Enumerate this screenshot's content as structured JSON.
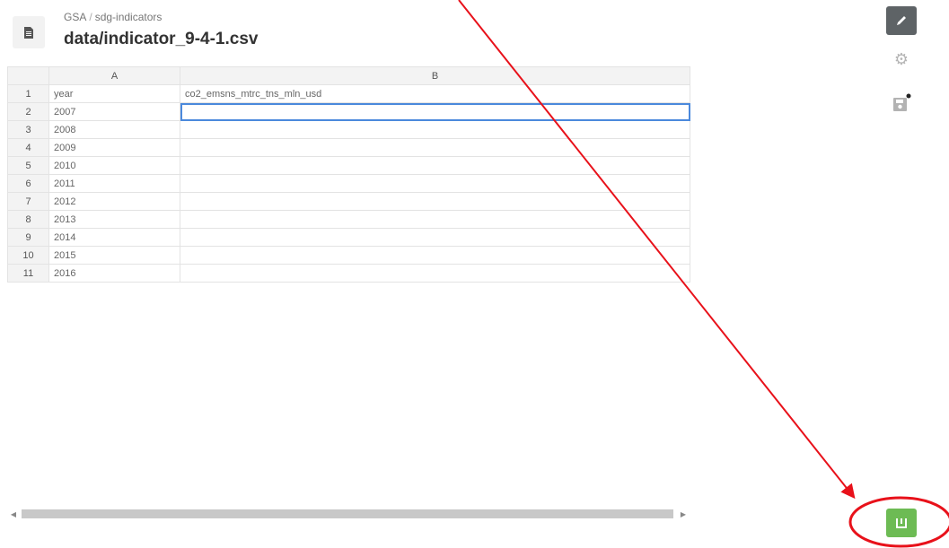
{
  "header": {
    "org": "GSA",
    "separator": "/",
    "repo": "sdg-indicators",
    "filename": "data/indicator_9-4-1.csv"
  },
  "grid": {
    "columns": [
      "A",
      "B"
    ],
    "rows": [
      {
        "num": "1",
        "a": "year",
        "b": "co2_emsns_mtrc_tns_mln_usd"
      },
      {
        "num": "2",
        "a": "2007",
        "b": ""
      },
      {
        "num": "3",
        "a": "2008",
        "b": ""
      },
      {
        "num": "4",
        "a": "2009",
        "b": ""
      },
      {
        "num": "5",
        "a": "2010",
        "b": ""
      },
      {
        "num": "6",
        "a": "2011",
        "b": ""
      },
      {
        "num": "7",
        "a": "2012",
        "b": ""
      },
      {
        "num": "8",
        "a": "2013",
        "b": ""
      },
      {
        "num": "9",
        "a": "2014",
        "b": ""
      },
      {
        "num": "10",
        "a": "2015",
        "b": ""
      },
      {
        "num": "11",
        "a": "2016",
        "b": ""
      }
    ],
    "selected_cell": "B2"
  },
  "toolbar": {
    "edit_icon": "pencil-icon",
    "settings_icon": "gear-icon",
    "save_icon": "save-icon",
    "publish_icon": "publish-icon"
  },
  "colors": {
    "edit_button": "#5e6366",
    "publish_button": "#6dbb54",
    "annotation": "#e8111a",
    "selection": "#4b89dc"
  }
}
